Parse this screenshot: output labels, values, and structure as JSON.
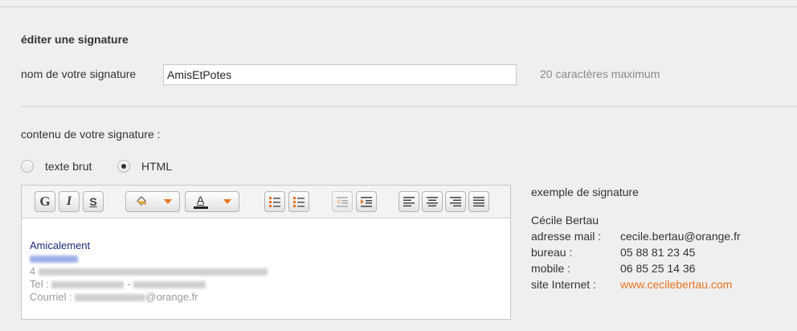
{
  "section_title": "éditer une signature",
  "name_field": {
    "label": "nom de votre signature",
    "value": "AmisEtPotes",
    "hint": "20 caractères maximum"
  },
  "content_label": "contenu de votre signature :",
  "format_options": [
    {
      "label": "texte brut",
      "checked": false
    },
    {
      "label": "HTML",
      "checked": true
    }
  ],
  "toolbar": {
    "bold": "G",
    "italic": "I",
    "underline": "S",
    "font_color_letter": "A",
    "fill_color_icon": "paint-bucket-icon",
    "font_color_icon": "font-color-icon",
    "accent_color": "#e8741f"
  },
  "editor": {
    "greeting": "Amicalement",
    "address_prefix": "4",
    "tel_label": "Tel :",
    "tel_separator": "-",
    "email_label": "Courriel :",
    "email_domain": "@orange.fr"
  },
  "example": {
    "title": "exemple de signature",
    "name": "Cécile Bertau",
    "rows": [
      {
        "key": "adresse mail :",
        "value": "cecile.bertau@orange.fr"
      },
      {
        "key": "bureau :",
        "value": "05 88 81 23 45"
      },
      {
        "key": "mobile :",
        "value": "06 85 25 14 36"
      },
      {
        "key": "site Internet :",
        "value": "www.cecilebertau.com"
      }
    ],
    "link_color": "#e8741f"
  }
}
